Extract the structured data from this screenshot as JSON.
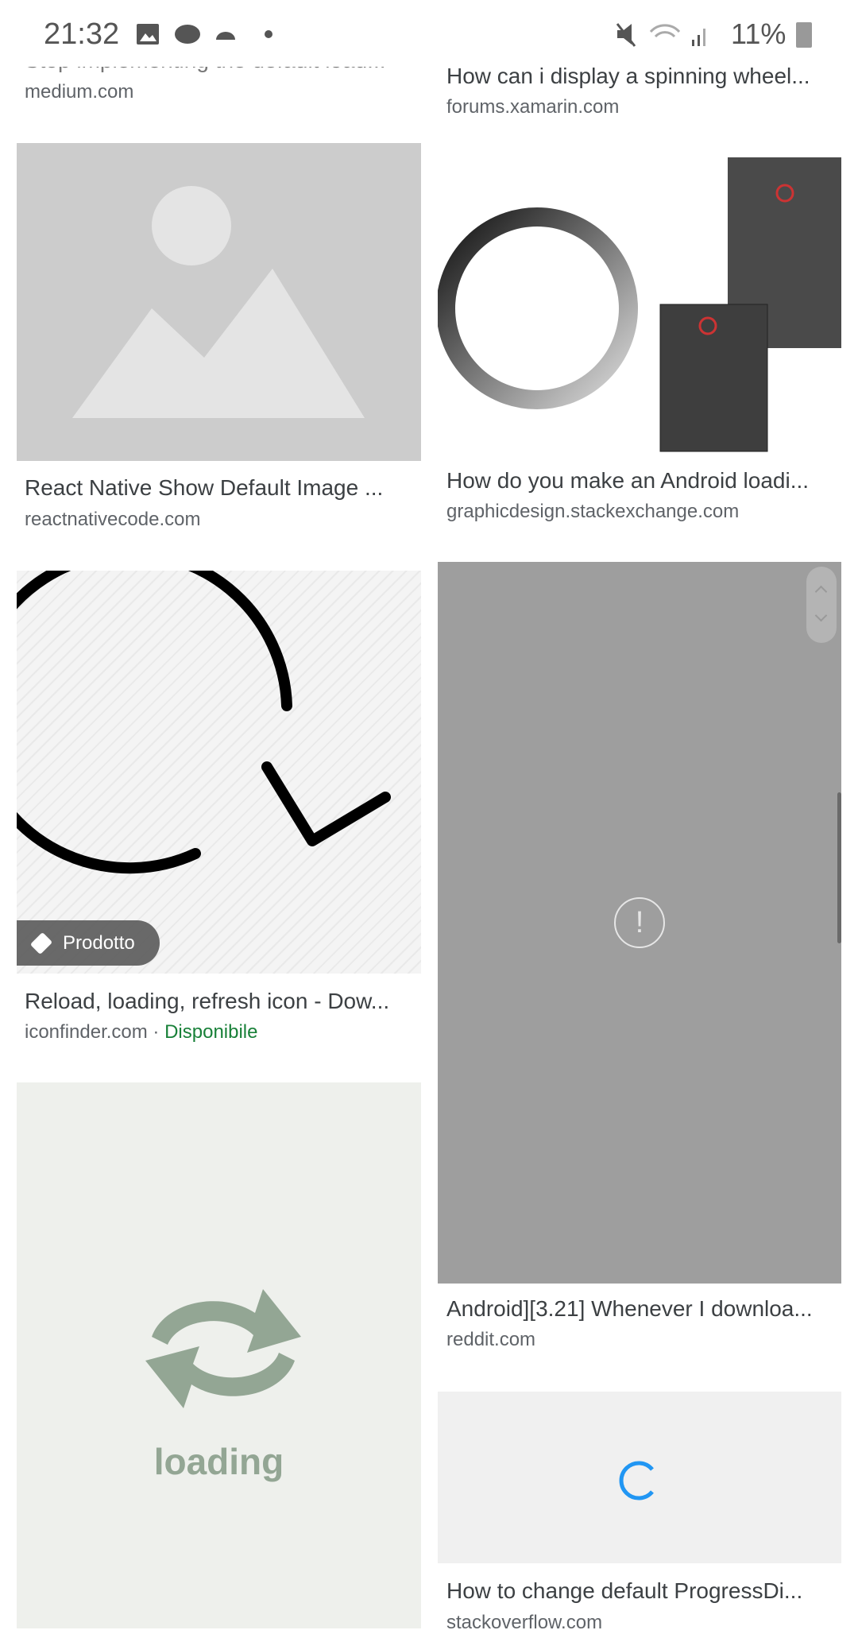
{
  "status_bar": {
    "time": "21:32",
    "battery": "11%"
  },
  "results": [
    {
      "title": "Stop implementing the default load...",
      "source": "medium.com"
    },
    {
      "title": "How can i display a spinning wheel...",
      "source": "forums.xamarin.com"
    },
    {
      "title": "React Native Show Default Image ...",
      "source": "reactnativecode.com"
    },
    {
      "title": "How do you make an Android loadi...",
      "source": "graphicdesign.stackexchange.com"
    },
    {
      "title": "Reload, loading, refresh icon - Dow...",
      "source": "iconfinder.com",
      "availability": "Disponibile",
      "badge": "Prodotto"
    },
    {
      "title": "Android][3.21] Whenever I downloa...",
      "source": "reddit.com"
    },
    {
      "title": "",
      "source": "",
      "image_text": "loading"
    },
    {
      "title": "How to change default ProgressDi...",
      "source": "stackoverflow.com"
    }
  ],
  "colors": {
    "availability": "#188038",
    "spinner": "#2196f3",
    "error_image_bg": "#9e9e9e"
  }
}
